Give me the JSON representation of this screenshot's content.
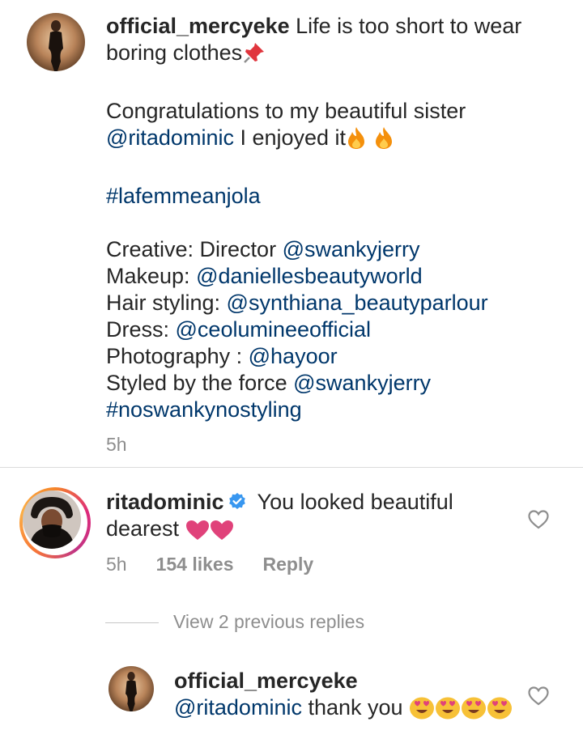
{
  "caption": {
    "username": "official_mercyeke",
    "line1": " Life is too short to wear boring clothes",
    "pin_emoji": "pushpin-icon",
    "congrats_prefix": "Congratulations to my beautiful sister ",
    "congrats_mention": "@ritadominic",
    "congrats_suffix": " I enjoyed it",
    "fire_emoji": "fire-icon",
    "hashtag1": "#lafemmeanjola",
    "credits": [
      {
        "label": "Creative: Director ",
        "handle": "@swankyjerry"
      },
      {
        "label": "Makeup: ",
        "handle": "@daniellesbeautyworld"
      },
      {
        "label": "Hair styling: ",
        "handle": "@synthiana_beautyparlour"
      },
      {
        "label": "Dress: ",
        "handle": "@ceolumineeofficial"
      },
      {
        "label": "Photography : ",
        "handle": "@hayoor"
      },
      {
        "label": "Styled by the force ",
        "handle": "@swankyjerry"
      }
    ],
    "hashtag2": "#noswankynostyling",
    "time": "5h"
  },
  "comment": {
    "username": "ritadominic",
    "text": " You looked beautiful dearest ",
    "time": "5h",
    "likes": "154 likes",
    "reply_label": "Reply",
    "colors": {
      "heart": "#e0427a",
      "verified": "#3897f0"
    }
  },
  "view_replies": "View 2 previous replies",
  "reply": {
    "username": "official_mercyeke",
    "mention": "@ritadominic",
    "text": " thank you "
  }
}
